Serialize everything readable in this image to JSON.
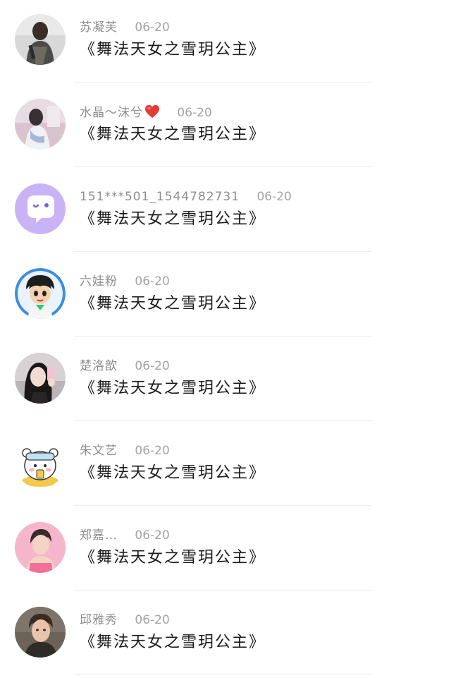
{
  "comments": [
    {
      "name": "苏凝芙",
      "date": "06-20",
      "message": "《舞法天女之雪玥公主》",
      "heart": false,
      "avatar_icon": "avatar-dark-figure-icon",
      "avatar_color": "#6b6b6b"
    },
    {
      "name": "水晶～沫兮",
      "date": "06-20",
      "message": "《舞法天女之雪玥公主》",
      "heart": true,
      "heart_color": "#e53935",
      "avatar_icon": "avatar-pink-room-icon",
      "avatar_color": "#d9c3cf"
    },
    {
      "name": "151***501_1544782731",
      "date": "06-20",
      "message": "《舞法天女之雪玥公主》",
      "heart": false,
      "avatar_icon": "default-chat-bubble-avatar-icon",
      "avatar_color": "#c9b3f7"
    },
    {
      "name": "六娃粉",
      "date": "06-20",
      "message": "《舞法天女之雪玥公主》",
      "heart": false,
      "avatar_icon": "cartoon-boy-avatar-icon",
      "avatar_color": "#3b8be0"
    },
    {
      "name": "楚洛歆",
      "date": "06-20",
      "message": "《舞法天女之雪玥公主》",
      "heart": false,
      "avatar_icon": "selfie-girl-avatar-icon",
      "avatar_color": "#9a8f95"
    },
    {
      "name": "朱文艺",
      "date": "06-20",
      "message": "《舞法天女之雪玥公主》",
      "heart": false,
      "avatar_icon": "cartoon-bear-avatar-icon",
      "avatar_color": "#f2c94c"
    },
    {
      "name": "郑嘉…",
      "date": "06-20",
      "message": "《舞法天女之雪玥公主》",
      "heart": false,
      "avatar_icon": "pink-portrait-avatar-icon",
      "avatar_color": "#f3a6c0"
    },
    {
      "name": "邱雅秀",
      "date": "06-20",
      "message": "《舞法天女之雪玥公主》",
      "heart": false,
      "avatar_icon": "man-portrait-avatar-icon",
      "avatar_color": "#5d5750"
    }
  ]
}
